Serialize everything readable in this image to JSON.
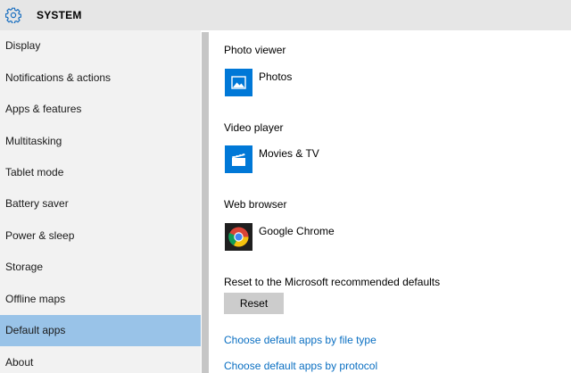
{
  "header": {
    "title": "SYSTEM",
    "icon": "gear-icon"
  },
  "sidebar": {
    "items": [
      {
        "label": "Display"
      },
      {
        "label": "Notifications & actions"
      },
      {
        "label": "Apps & features"
      },
      {
        "label": "Multitasking"
      },
      {
        "label": "Tablet mode"
      },
      {
        "label": "Battery saver"
      },
      {
        "label": "Power & sleep"
      },
      {
        "label": "Storage"
      },
      {
        "label": "Offline maps"
      },
      {
        "label": "Default apps"
      },
      {
        "label": "About"
      }
    ],
    "selected": "Default apps"
  },
  "main": {
    "photo_viewer": {
      "label": "Photo viewer",
      "app": "Photos",
      "icon": "photos-icon"
    },
    "video_player": {
      "label": "Video player",
      "app": "Movies & TV",
      "icon": "movies-tv-icon"
    },
    "web_browser": {
      "label": "Web browser",
      "app": "Google Chrome",
      "icon": "chrome-icon"
    },
    "reset": {
      "label": "Reset to the Microsoft recommended defaults",
      "button_label": "Reset"
    },
    "links": {
      "by_file_type": "Choose default apps by file type",
      "by_protocol": "Choose default apps by protocol"
    }
  },
  "colors": {
    "accent": "#0078d7",
    "selected_nav": "#99c3e8",
    "link": "#0a6fc2",
    "sidebar_bg": "#f2f2f2",
    "header_bg": "#e6e6e6"
  }
}
